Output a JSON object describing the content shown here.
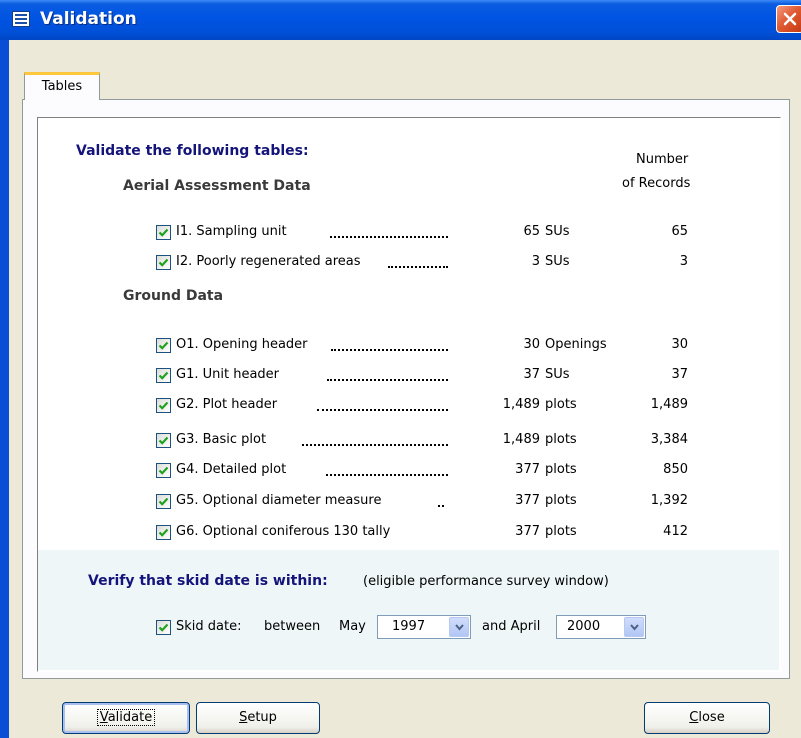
{
  "window": {
    "title": "Validation",
    "close_label": "×"
  },
  "tabs": [
    {
      "label": "Tables"
    }
  ],
  "tables_section": {
    "heading": "Validate the following tables:",
    "count_header_line1": "Number",
    "count_header_line2": "of Records",
    "groups": [
      {
        "title": "Aerial Assessment Data",
        "items": [
          {
            "label": "I1. Sampling unit",
            "count": "65",
            "unit": "SUs",
            "records": "65",
            "checked": true
          },
          {
            "label": "I2. Poorly regenerated areas",
            "count": "3",
            "unit": "SUs",
            "records": "3",
            "checked": true
          }
        ]
      },
      {
        "title": "Ground Data",
        "items": [
          {
            "label": "O1. Opening header",
            "count": "30",
            "unit": "Openings",
            "records": "30",
            "checked": true
          },
          {
            "label": "G1. Unit header",
            "count": "37",
            "unit": "SUs",
            "records": "37",
            "checked": true
          },
          {
            "label": "G2. Plot header",
            "count": "1,489",
            "unit": "plots",
            "records": "1,489",
            "checked": true
          },
          {
            "label": "G3. Basic plot",
            "count": "1,489",
            "unit": "plots",
            "records": "3,384",
            "checked": true
          },
          {
            "label": "G4. Detailed plot",
            "count": "377",
            "unit": "plots",
            "records": "850",
            "checked": true
          },
          {
            "label": "G5. Optional diameter measure",
            "count": "377",
            "unit": "plots",
            "records": "1,392",
            "checked": true
          },
          {
            "label": "G6. Optional coniferous 130 tally",
            "count": "377",
            "unit": "plots",
            "records": "412",
            "checked": true
          }
        ]
      }
    ]
  },
  "skid_section": {
    "heading": "Verify that skid date is within:",
    "note": "(eligible performance survey window)",
    "checkbox_label": "Skid date:",
    "between_label": "between",
    "start_month": "May",
    "start_year": "1997",
    "and_label": "and April",
    "end_year": "2000",
    "checked": true
  },
  "buttons": {
    "validate": {
      "first": "V",
      "rest": "alidate"
    },
    "setup": {
      "first": "S",
      "rest": "etup"
    },
    "close": {
      "first": "C",
      "rest": "lose"
    }
  },
  "colors": {
    "title_bar": "#0054e3",
    "heading_blue": "#14147a",
    "tab_accent": "#ffc83c",
    "close_red": "#e05a32"
  }
}
